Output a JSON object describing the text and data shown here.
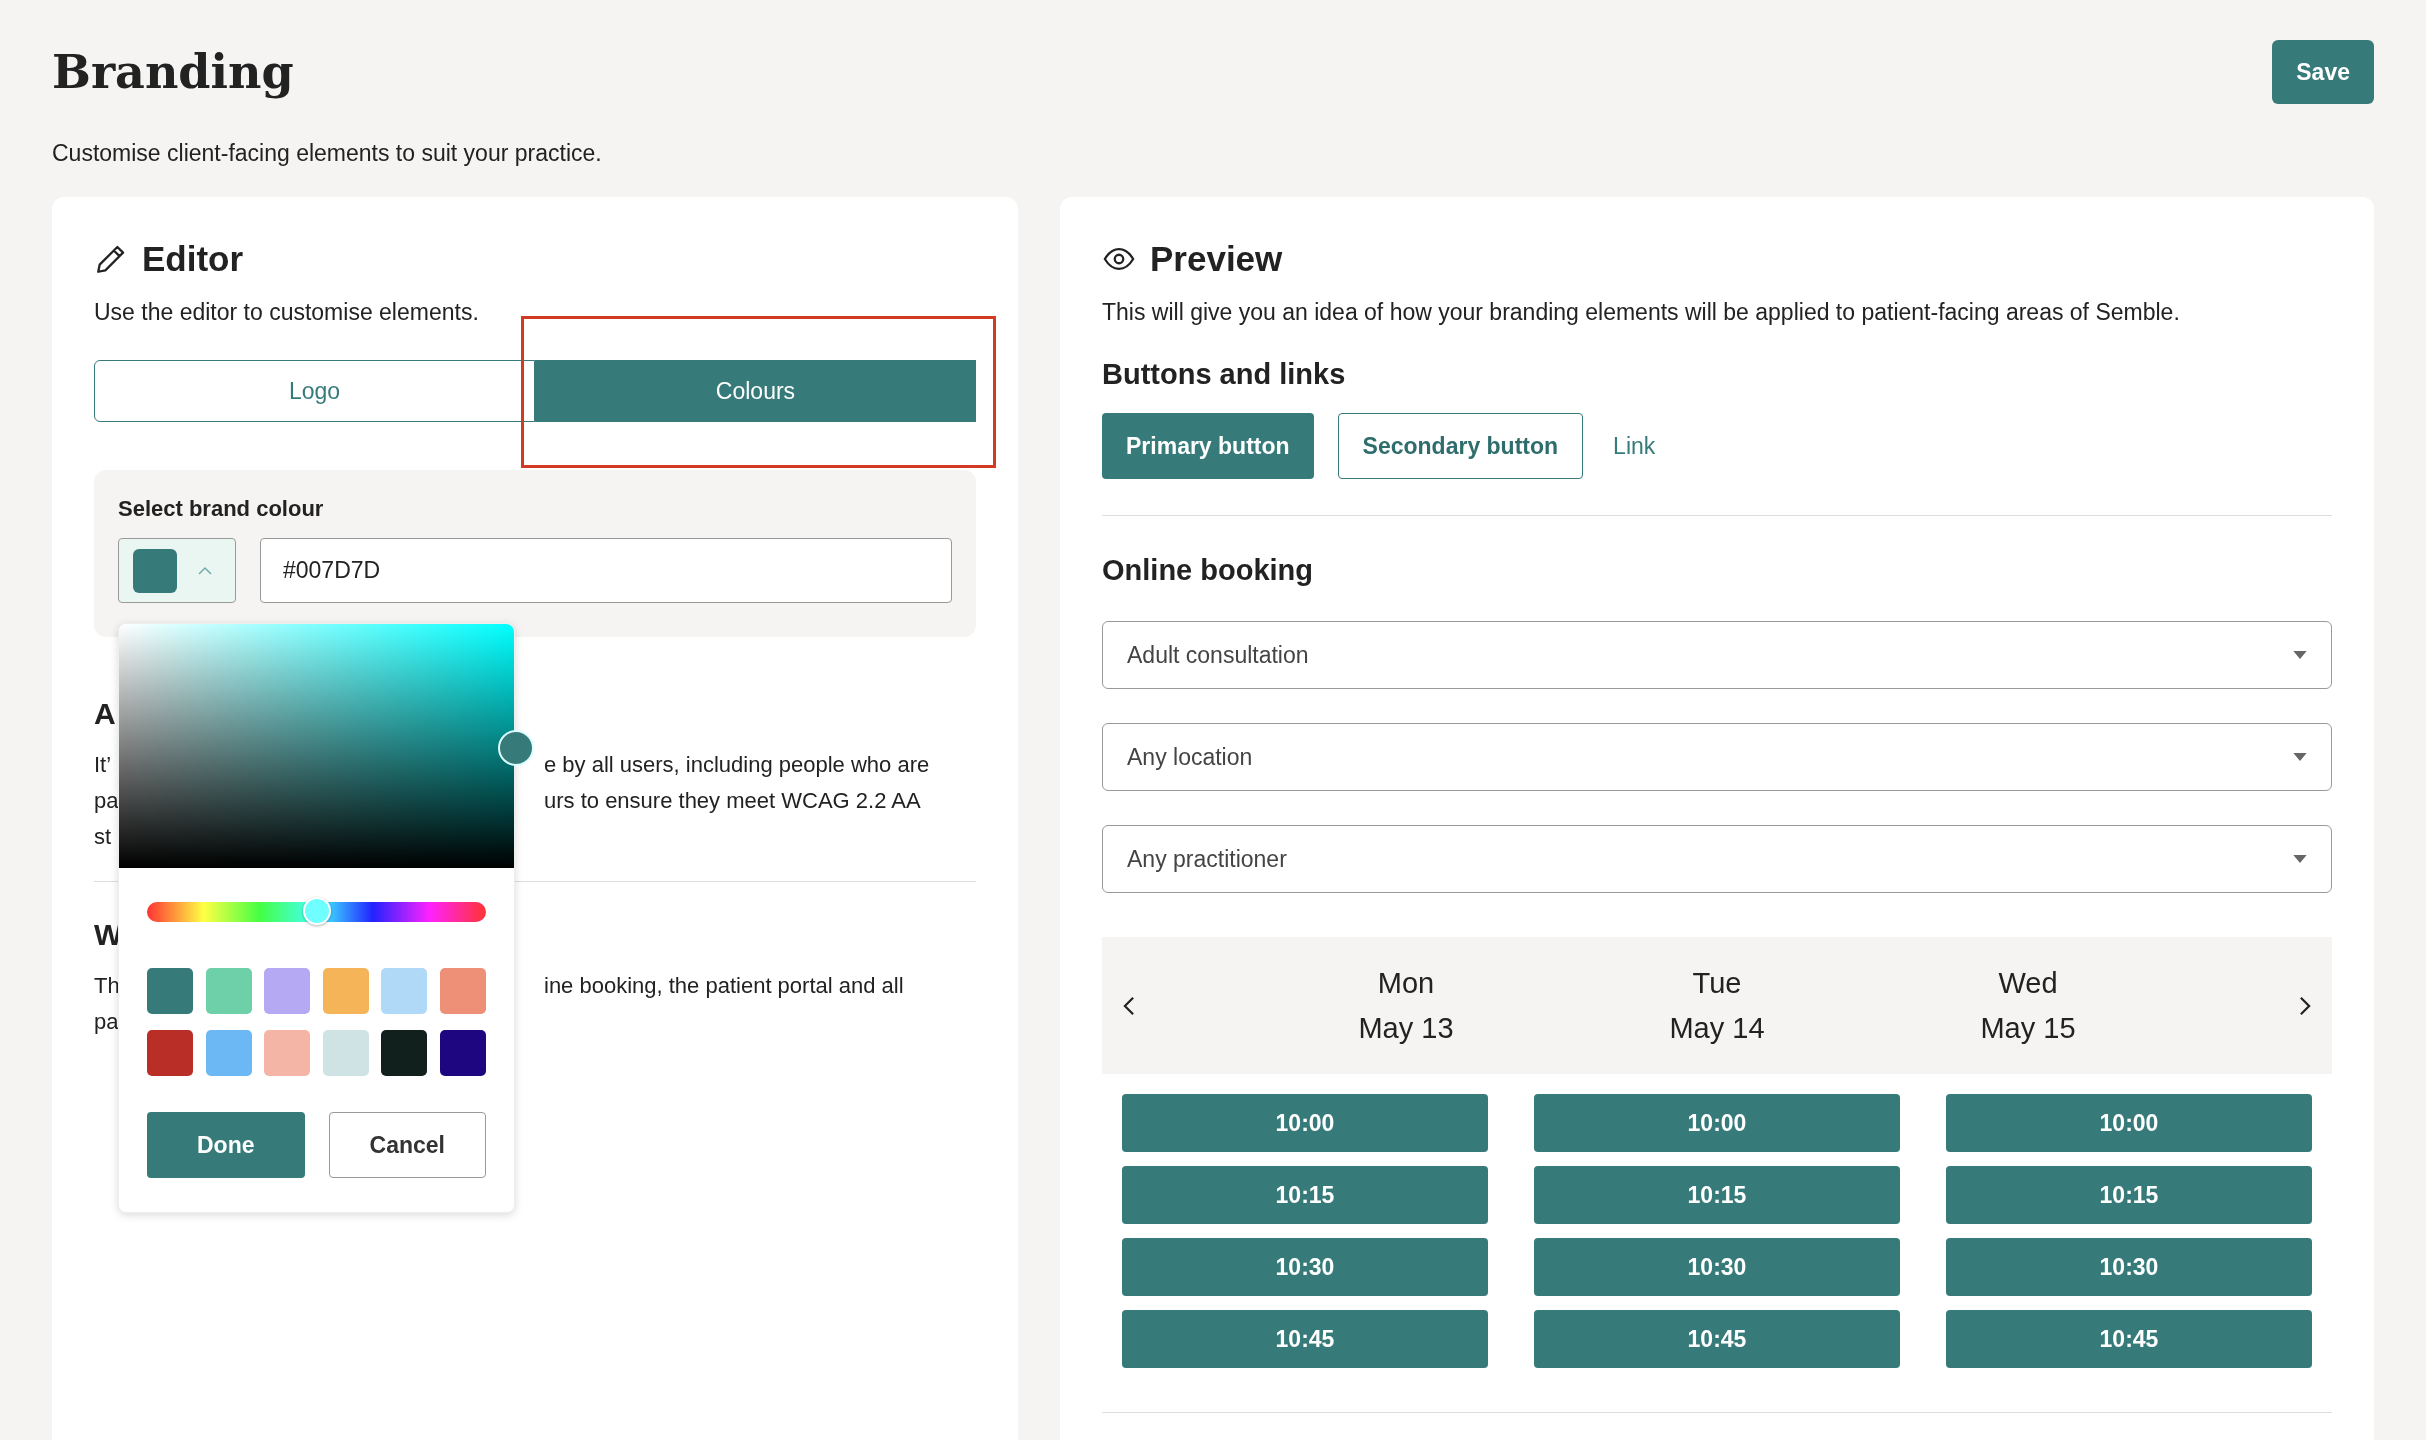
{
  "page": {
    "title": "Branding",
    "subtitle": "Customise client-facing elements to suit your practice.",
    "save_button": "Save"
  },
  "editor": {
    "title": "Editor",
    "description": "Use the editor to customise elements.",
    "tabs": [
      {
        "label": "Logo",
        "selected": false,
        "highlighted": false
      },
      {
        "label": "Colours",
        "selected": true,
        "highlighted": true
      }
    ],
    "brand_colour": {
      "label": "Select brand colour",
      "value": "#007D7D"
    },
    "colour_picker": {
      "hue": {
        "level": 0.5
      },
      "swatches": [
        {
          "color": "#367b7a"
        },
        {
          "color": "#6dd0a8"
        },
        {
          "color": "#b5a9f4"
        },
        {
          "color": "#f4b457"
        },
        {
          "color": "#b0d9f8"
        },
        {
          "color": "#ee8f78"
        },
        {
          "color": "#b92f27"
        },
        {
          "color": "#6cb8f5"
        },
        {
          "color": "#f4b5a6"
        },
        {
          "color": "#d0e3e4"
        },
        {
          "color": "#11201c"
        },
        {
          "color": "#1e0680"
        }
      ],
      "buttons": [
        "Done",
        "Cancel"
      ]
    },
    "obscured_sections": [
      {
        "heading": "A",
        "lines": [
          {
            "left": "It’",
            "right": "e by all users, including people who are"
          },
          {
            "left": "pa",
            "right": "urs to ensure they meet WCAG 2.2 AA"
          },
          {
            "left": "st"
          }
        ]
      },
      {
        "heading": "W",
        "lines": [
          {
            "left": "Th",
            "right": "ine booking, the patient portal and all"
          },
          {
            "left": "pa"
          }
        ]
      }
    ]
  },
  "preview": {
    "title": "Preview",
    "description": "This will give you an idea of how your branding elements will be applied to patient-facing areas of Semble.",
    "buttons_heading": "Buttons and links",
    "primary_button": "Primary button",
    "secondary_button": "Secondary button",
    "link": "Link",
    "booking_heading": "Online booking",
    "selects": [
      "Adult consultation",
      "Any location",
      "Any practitioner"
    ],
    "days": [
      {
        "day": "Mon",
        "date": "May 13",
        "slots": [
          "10:00",
          "10:15",
          "10:30",
          "10:45"
        ]
      },
      {
        "day": "Tue",
        "date": "May 14",
        "slots": [
          "10:00",
          "10:15",
          "10:30",
          "10:45"
        ]
      },
      {
        "day": "Wed",
        "date": "May 15",
        "slots": [
          "10:00",
          "10:15",
          "10:30",
          "10:45"
        ]
      }
    ]
  }
}
